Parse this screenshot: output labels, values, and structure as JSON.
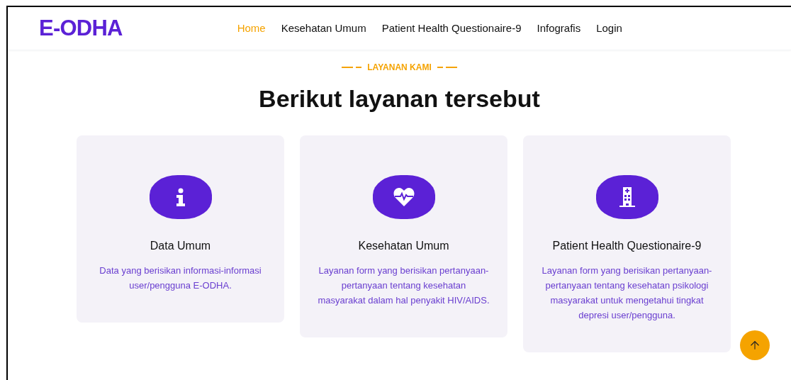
{
  "brand": "E-ODHA",
  "nav": [
    {
      "label": "Home",
      "selected": true
    },
    {
      "label": "Kesehatan Umum",
      "selected": false
    },
    {
      "label": "Patient Health Questionaire-9",
      "selected": false
    },
    {
      "label": "Infografis",
      "selected": false
    },
    {
      "label": "Login",
      "selected": false
    }
  ],
  "section": {
    "eyebrow": "LAYANAN KAMI",
    "title": "Berikut layanan tersebut"
  },
  "cards": [
    {
      "kind": "info",
      "title": "Data Umum",
      "text": "Data yang berisikan informasi-informasi user/pengguna E-ODHA."
    },
    {
      "kind": "heart",
      "title": "Kesehatan Umum",
      "text": "Layanan form yang berisikan pertanyaan-pertanyaan tentang kesehatan masyarakat dalam hal penyakit HIV/AIDS."
    },
    {
      "kind": "hospital",
      "title": "Patient Health Questionaire-9",
      "text": "Layanan form yang berisikan pertanyaan-pertanyaan tentang kesehatan psikologi masyarakat untuk mengetahui tingkat depresi user/pengguna."
    }
  ]
}
